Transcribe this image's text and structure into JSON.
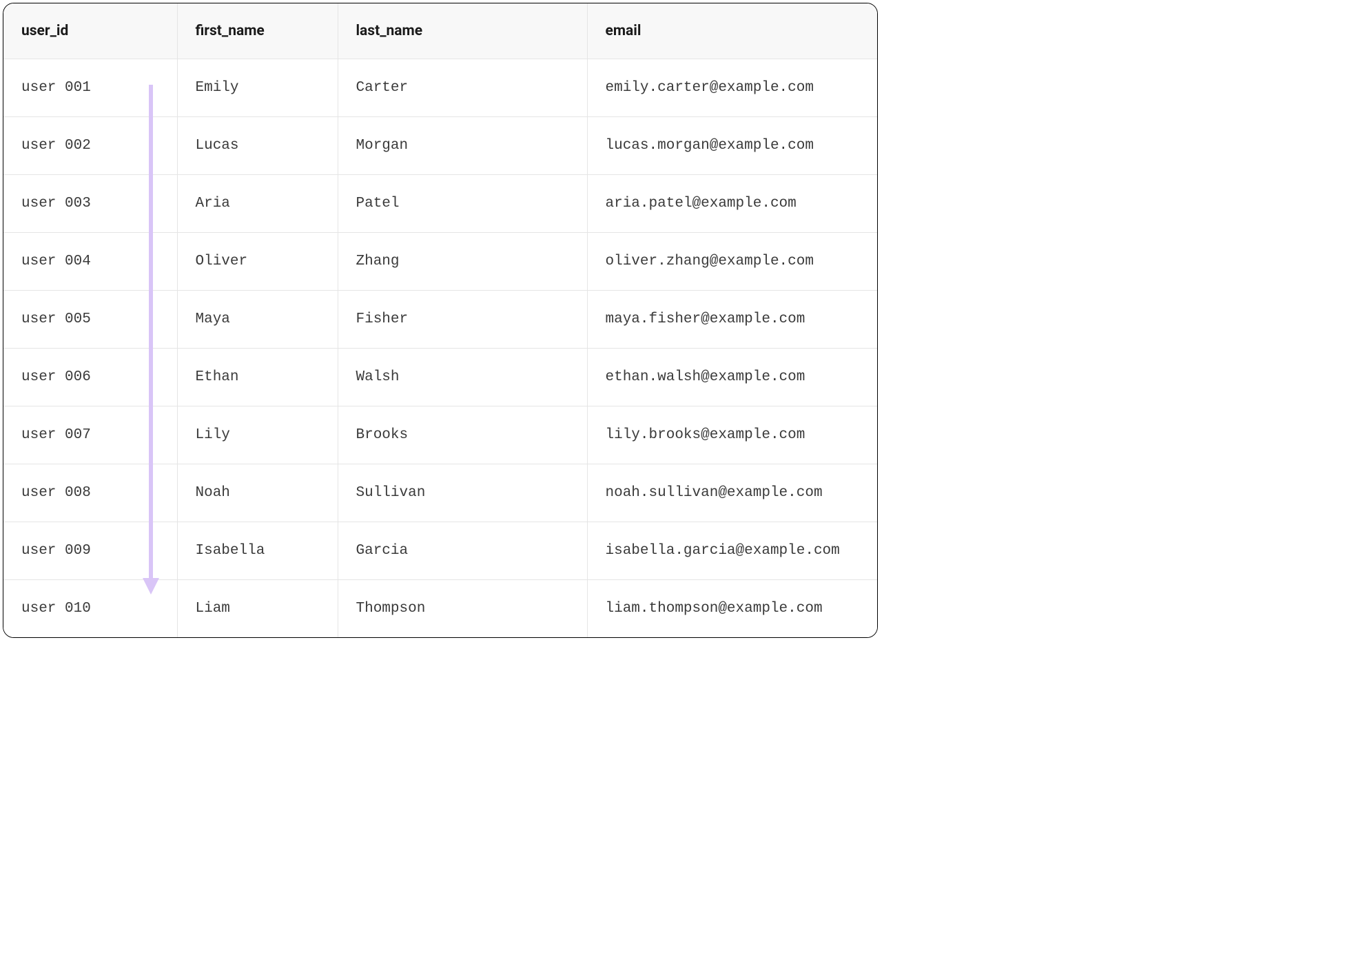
{
  "table": {
    "headers": {
      "user_id": "user_id",
      "first_name": "first_name",
      "last_name": "last_name",
      "email": "email"
    },
    "rows": [
      {
        "user_id": "user 001",
        "first_name": "Emily",
        "last_name": "Carter",
        "email": "emily.carter@example.com"
      },
      {
        "user_id": "user 002",
        "first_name": "Lucas",
        "last_name": "Morgan",
        "email": "lucas.morgan@example.com"
      },
      {
        "user_id": "user 003",
        "first_name": "Aria",
        "last_name": "Patel",
        "email": "aria.patel@example.com"
      },
      {
        "user_id": "user 004",
        "first_name": "Oliver",
        "last_name": "Zhang",
        "email": "oliver.zhang@example.com"
      },
      {
        "user_id": "user 005",
        "first_name": "Maya",
        "last_name": "Fisher",
        "email": "maya.fisher@example.com"
      },
      {
        "user_id": "user 006",
        "first_name": "Ethan",
        "last_name": "Walsh",
        "email": "ethan.walsh@example.com"
      },
      {
        "user_id": "user 007",
        "first_name": "Lily",
        "last_name": "Brooks",
        "email": "lily.brooks@example.com"
      },
      {
        "user_id": "user 008",
        "first_name": "Noah",
        "last_name": "Sullivan",
        "email": "noah.sullivan@example.com"
      },
      {
        "user_id": "user 009",
        "first_name": "Isabella",
        "last_name": "Garcia",
        "email": "isabella.garcia@example.com"
      },
      {
        "user_id": "user 010",
        "first_name": "Liam",
        "last_name": "Thompson",
        "email": "liam.thompson@example.com"
      }
    ]
  },
  "annotation": {
    "arrow_color": "#d9c5f7"
  }
}
